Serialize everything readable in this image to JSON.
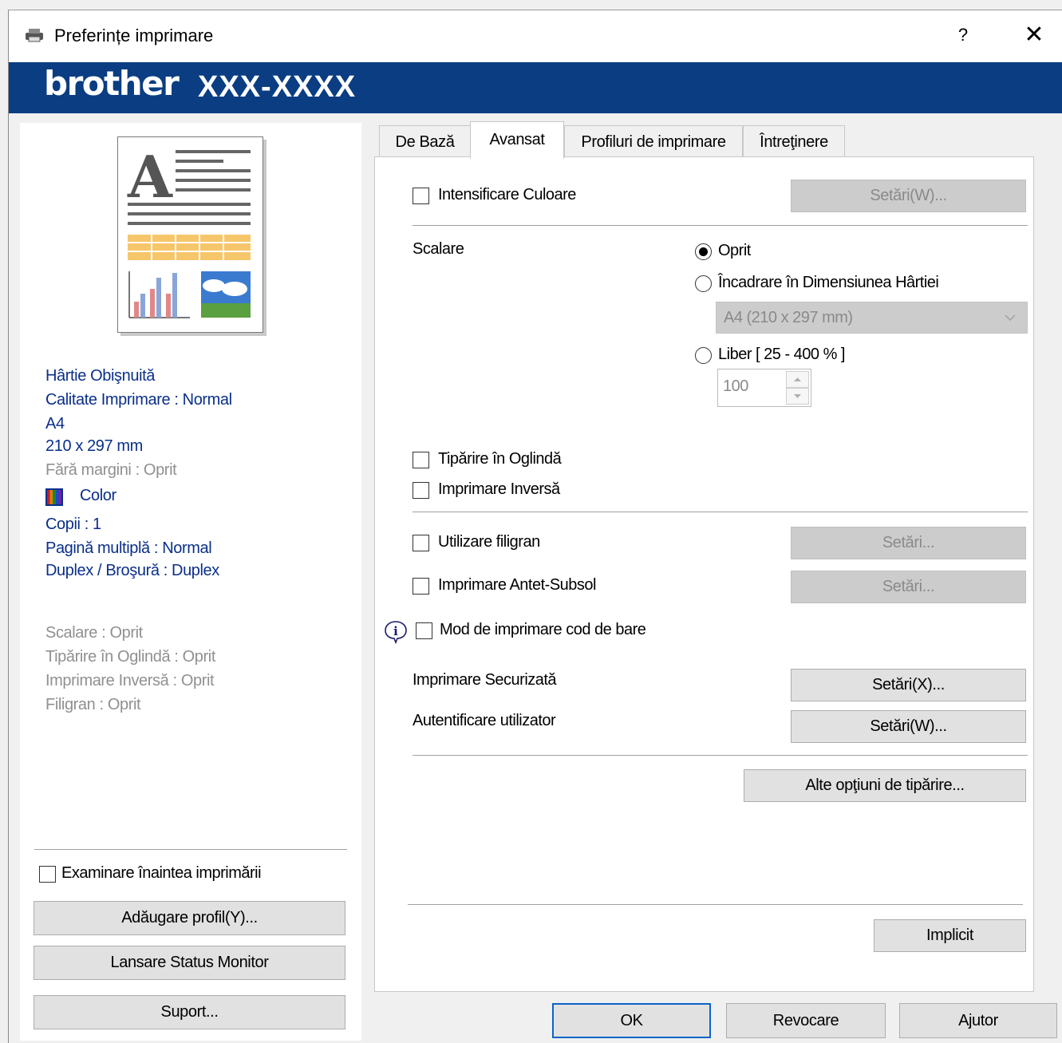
{
  "window": {
    "title": "Preferințe imprimare",
    "help": "?",
    "close": "✕"
  },
  "banner": {
    "brand": "brother",
    "model": "XXX-XXXX"
  },
  "summary": {
    "paper_type": "Hârtie Obişnuită",
    "quality": "Calitate Imprimare : Normal",
    "paper_size": "A4",
    "dimensions": "210 x 297 mm",
    "borderless": "Fără margini : Oprit",
    "color": "Color",
    "copies": "Copii : 1",
    "multipage": "Pagină multiplă : Normal",
    "duplex": "Duplex / Broşură : Duplex",
    "scaling": "Scalare : Oprit",
    "mirror": "Tipărire în Oglindă : Oprit",
    "reverse": "Imprimare Inversă : Oprit",
    "watermark": "Filigran : Oprit"
  },
  "left_controls": {
    "preview_checkbox": "Examinare înaintea imprimării",
    "add_profile": "Adăugare profil(Y)...",
    "status_monitor": "Lansare Status Monitor",
    "support": "Suport..."
  },
  "tabs": [
    {
      "label": "De Bază",
      "active": false
    },
    {
      "label": "Avansat",
      "active": true
    },
    {
      "label": "Profiluri de imprimare",
      "active": false
    },
    {
      "label": "Întreţinere",
      "active": false
    }
  ],
  "advanced": {
    "color_enhance": {
      "label": "Intensificare Culoare",
      "checked": false,
      "button": "Setări(W)..."
    },
    "scaling": {
      "label": "Scalare",
      "off": "Oprit",
      "fit": "Încadrare în Dimensiunea Hârtiei",
      "paper": "A4 (210 x 297 mm)",
      "free": "Liber [ 25 - 400 % ]",
      "value": "100",
      "selected": "off"
    },
    "mirror": {
      "label": "Tipărire în Oglindă",
      "checked": false
    },
    "reverse": {
      "label": "Imprimare Inversă",
      "checked": false
    },
    "watermark": {
      "label": "Utilizare filigran",
      "checked": false,
      "button": "Setări..."
    },
    "header_footer": {
      "label": "Imprimare Antet-Subsol",
      "checked": false,
      "button": "Setări..."
    },
    "barcode": {
      "label": "Mod de imprimare cod de bare",
      "checked": false
    },
    "secure_print": {
      "label": "Imprimare Securizată",
      "button": "Setări(X)..."
    },
    "user_auth": {
      "label": "Autentificare utilizator",
      "button": "Setări(W)..."
    },
    "other_options": "Alte opţiuni de tipărire...",
    "default": "Implicit"
  },
  "footer": {
    "ok": "OK",
    "cancel": "Revocare",
    "help": "Ajutor"
  },
  "colors": {
    "banner": "#0a3d82",
    "summary_text": "#0a2f8a",
    "focus": "#0a64c8"
  }
}
